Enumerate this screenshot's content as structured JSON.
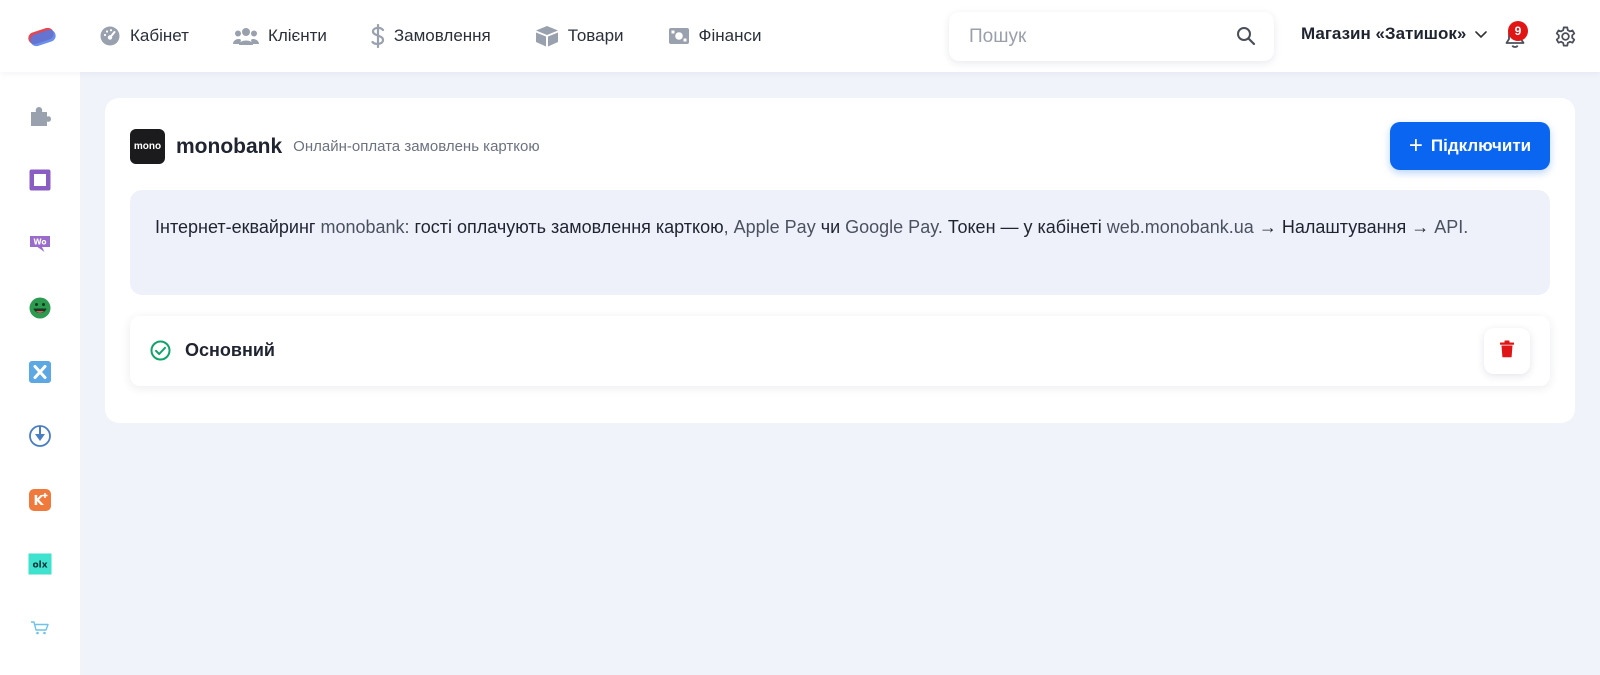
{
  "nav": {
    "items": [
      {
        "label": "Кабінет",
        "icon": "dashboard-icon"
      },
      {
        "label": "Клієнти",
        "icon": "users-icon"
      },
      {
        "label": "Замовлення",
        "icon": "dollar-icon"
      },
      {
        "label": "Товари",
        "icon": "box-icon"
      },
      {
        "label": "Фінанси",
        "icon": "money-icon"
      }
    ]
  },
  "search": {
    "placeholder": "Пошук",
    "value": ""
  },
  "store": {
    "label": "Магазин «Затишок»"
  },
  "notifications": {
    "count": "9"
  },
  "sidebar": {
    "items": [
      {
        "icon": "puzzle-icon"
      },
      {
        "icon": "square-frame-icon"
      },
      {
        "icon": "woo-icon"
      },
      {
        "icon": "smiley-icon"
      },
      {
        "icon": "x-app-icon"
      },
      {
        "icon": "download-circle-icon"
      },
      {
        "icon": "k-plus-icon"
      },
      {
        "icon": "olx-icon"
      },
      {
        "icon": "cart-icon"
      }
    ]
  },
  "integration": {
    "logo_text": "mono",
    "name": "monobank",
    "description": "Онлайн-оплата замовлень карткою",
    "connect_label": "Підключити",
    "info": {
      "p1": "Інтернет-еквайринг ",
      "p2": "monobank:",
      "p3": " гості оплачують замовлення карткою",
      "p4": ", ",
      "p5": "Apple Pay",
      "p6": " чи ",
      "p7": "Google Pay.",
      "p8": " Токен — у кабінеті ",
      "p9": "web.monobank.ua",
      "p10": " → Налаштування → ",
      "p11": "API."
    },
    "accounts": [
      {
        "name": "Основний",
        "status": "active"
      }
    ]
  },
  "colors": {
    "accent": "#0a66f0",
    "danger": "#e01616",
    "success": "#12a36b",
    "background": "#f0f3fa"
  }
}
